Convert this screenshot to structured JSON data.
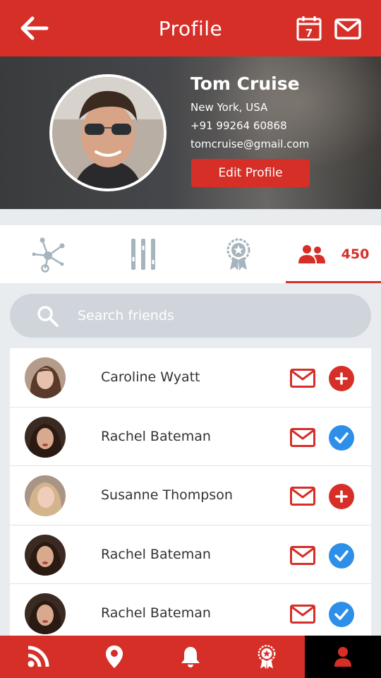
{
  "header": {
    "title": "Profile",
    "back_icon": "arrow-left-icon",
    "calendar_icon": "calendar-icon",
    "calendar_day": "7",
    "mail_icon": "mail-icon"
  },
  "profile": {
    "name": "Tom Cruise",
    "location": "New York, USA",
    "phone": "+91 99264 60868",
    "email": "tomcruise@gmail.com",
    "edit_button": "Edit Profile"
  },
  "tabs": [
    {
      "icon": "network-icon",
      "active": false
    },
    {
      "icon": "sliders-icon",
      "active": false
    },
    {
      "icon": "award-icon",
      "active": false
    },
    {
      "icon": "friends-icon",
      "active": true,
      "count": "450"
    }
  ],
  "search": {
    "placeholder": "Search friends",
    "value": ""
  },
  "friends": [
    {
      "name": "Caroline Wyatt",
      "status": "add"
    },
    {
      "name": "Rachel Bateman",
      "status": "added"
    },
    {
      "name": "Susanne Thompson",
      "status": "add"
    },
    {
      "name": "Rachel Bateman",
      "status": "added"
    },
    {
      "name": "Rachel Bateman",
      "status": "added"
    }
  ],
  "bottom_nav": [
    {
      "icon": "feed-icon",
      "active": false
    },
    {
      "icon": "location-pin-icon",
      "active": false
    },
    {
      "icon": "bell-icon",
      "active": false
    },
    {
      "icon": "award-icon",
      "active": false
    },
    {
      "icon": "user-icon",
      "active": true
    }
  ],
  "colors": {
    "primary": "#d62f28",
    "accent_blue": "#2d8fe8",
    "tab_icon_gray": "#a5b4bd",
    "search_bg": "#cfd5db",
    "background": "#e9ecef"
  }
}
